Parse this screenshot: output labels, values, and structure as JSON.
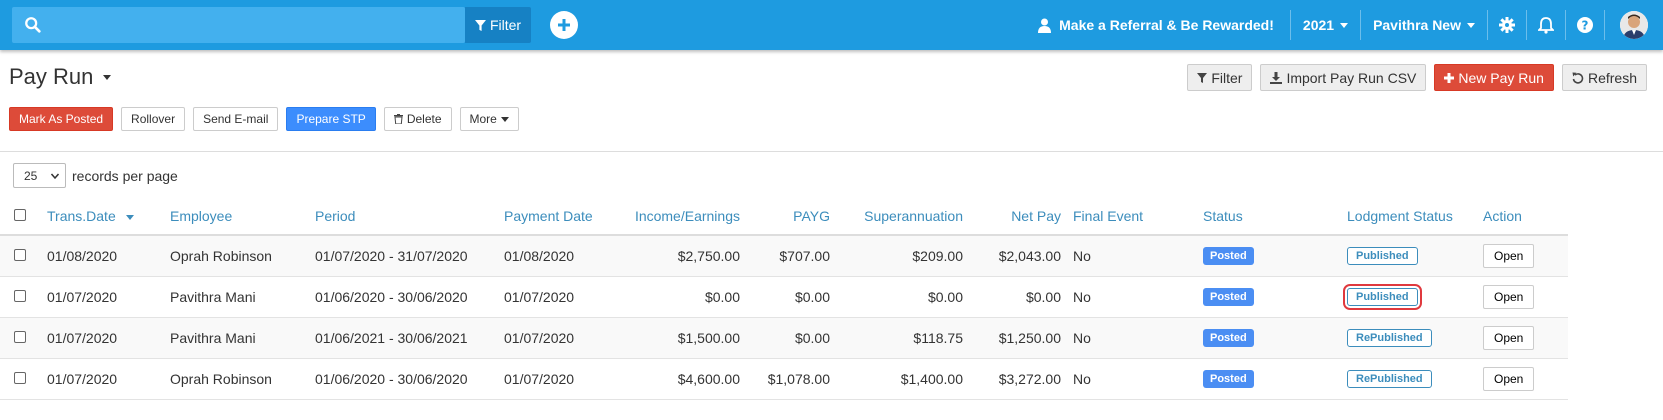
{
  "topbar": {
    "filter_label": "Filter",
    "search_placeholder": "",
    "referral_label": "Make a Referral & Be Rewarded!",
    "year": "2021",
    "user_name": "Pavithra New"
  },
  "page": {
    "title": "Pay Run",
    "header_actions": {
      "filter": "Filter",
      "import": "Import Pay Run CSV",
      "new": "New Pay Run",
      "refresh": "Refresh"
    },
    "toolbar": {
      "mark_posted": "Mark As Posted",
      "rollover": "Rollover",
      "send_email": "Send E-mail",
      "prepare_stp": "Prepare STP",
      "delete": "Delete",
      "more": "More"
    },
    "records": {
      "value": "25",
      "label": "records per page"
    }
  },
  "table": {
    "columns": [
      "Trans.Date",
      "Employee",
      "Period",
      "Payment Date",
      "Income/Earnings",
      "PAYG",
      "Superannuation",
      "Net Pay",
      "Final Event",
      "Status",
      "Lodgment Status",
      "Action"
    ],
    "rows": [
      {
        "date": "01/08/2020",
        "employee": "Oprah Robinson",
        "period": "01/07/2020 - 31/07/2020",
        "payment_date": "01/08/2020",
        "income": "$2,750.00",
        "payg": "$707.00",
        "super": "$209.00",
        "net": "$2,043.00",
        "final": "No",
        "status": "Posted",
        "lodgment": "Published",
        "action": "Open"
      },
      {
        "date": "01/07/2020",
        "employee": "Pavithra Mani",
        "period": "01/06/2020 - 30/06/2020",
        "payment_date": "01/07/2020",
        "income": "$0.00",
        "payg": "$0.00",
        "super": "$0.00",
        "net": "$0.00",
        "final": "No",
        "status": "Posted",
        "lodgment": "Published",
        "action": "Open"
      },
      {
        "date": "01/07/2020",
        "employee": "Pavithra Mani",
        "period": "01/06/2021 - 30/06/2021",
        "payment_date": "01/07/2020",
        "income": "$1,500.00",
        "payg": "$0.00",
        "super": "$118.75",
        "net": "$1,250.00",
        "final": "No",
        "status": "Posted",
        "lodgment": "RePublished",
        "action": "Open"
      },
      {
        "date": "01/07/2020",
        "employee": "Oprah Robinson",
        "period": "01/06/2020 - 30/06/2020",
        "payment_date": "01/07/2020",
        "income": "$4,600.00",
        "payg": "$1,078.00",
        "super": "$1,400.00",
        "net": "$3,272.00",
        "final": "No",
        "status": "Posted",
        "lodgment": "RePublished",
        "action": "Open"
      }
    ]
  },
  "colors": {
    "topbar": "#1e9be0",
    "accent_blue": "#3c8dbc",
    "danger_red": "#dd4b39",
    "primary_blue": "#3c8dfd"
  },
  "icons": [
    "search-icon",
    "filter-icon",
    "plus-circle-icon",
    "user-icon",
    "gear-icon",
    "bell-icon",
    "help-icon",
    "avatar",
    "download-icon",
    "plus-icon",
    "refresh-icon",
    "trash-icon",
    "chevron-down-icon"
  ]
}
